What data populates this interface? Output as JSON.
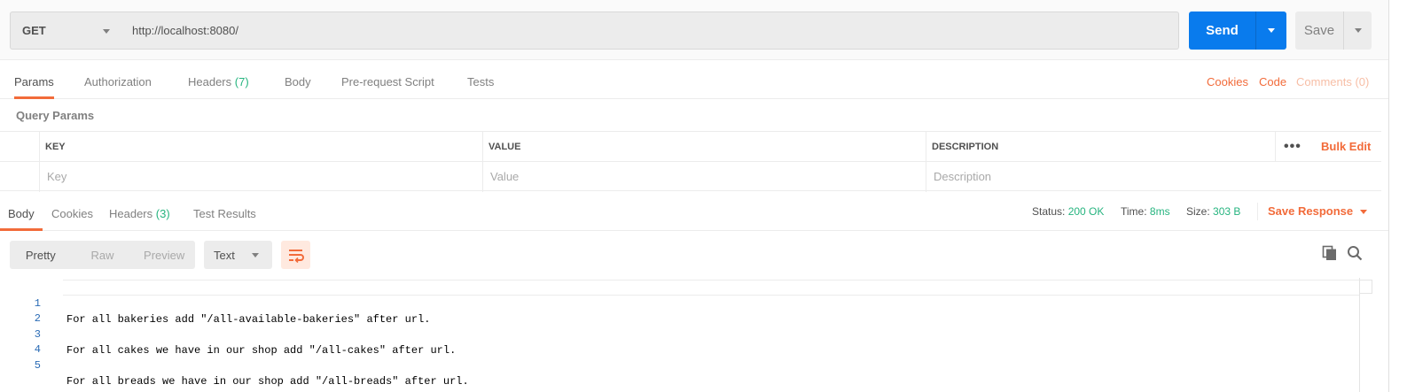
{
  "request": {
    "method": "GET",
    "url": "http://localhost:8080/",
    "send_label": "Send",
    "save_label": "Save"
  },
  "request_tabs": {
    "params": "Params",
    "authorization": "Authorization",
    "headers": "Headers",
    "headers_count": "(7)",
    "body": "Body",
    "pre_request": "Pre-request Script",
    "tests": "Tests",
    "cookies": "Cookies",
    "code": "Code",
    "comments": "Comments (0)"
  },
  "query_params": {
    "title": "Query Params",
    "columns": [
      "KEY",
      "VALUE",
      "DESCRIPTION"
    ],
    "placeholders": [
      "Key",
      "Value",
      "Description"
    ],
    "more": "•••",
    "bulk_edit": "Bulk Edit"
  },
  "response_tabs": {
    "body": "Body",
    "cookies": "Cookies",
    "headers": "Headers",
    "headers_count": "(3)",
    "test_results": "Test Results"
  },
  "response_meta": {
    "status_label": "Status:",
    "status_value": "200 OK",
    "time_label": "Time:",
    "time_value": "8ms",
    "size_label": "Size:",
    "size_value": "303 B",
    "save_response": "Save Response"
  },
  "body_toolbar": {
    "views": [
      "Pretty",
      "Raw",
      "Preview"
    ],
    "active_view": "Pretty",
    "format": "Text",
    "icons": [
      "wrap-lines-icon",
      "copy-icon",
      "search-icon"
    ]
  },
  "editor": {
    "lines": [
      {
        "num": "1",
        "text": "For all bakeries add \"/all-available-bakeries\" after url."
      },
      {
        "num": "2",
        "text": ""
      },
      {
        "num": "3",
        "text": "For all cakes we have in our shop add \"/all-cakes\" after url."
      },
      {
        "num": "4",
        "text": ""
      },
      {
        "num": "5",
        "text": "For all breads we have in our shop add \"/all-breads\" after url."
      }
    ]
  },
  "colors": {
    "accent": "#f26b3a",
    "send": "#097bed",
    "success": "#26b47f"
  }
}
